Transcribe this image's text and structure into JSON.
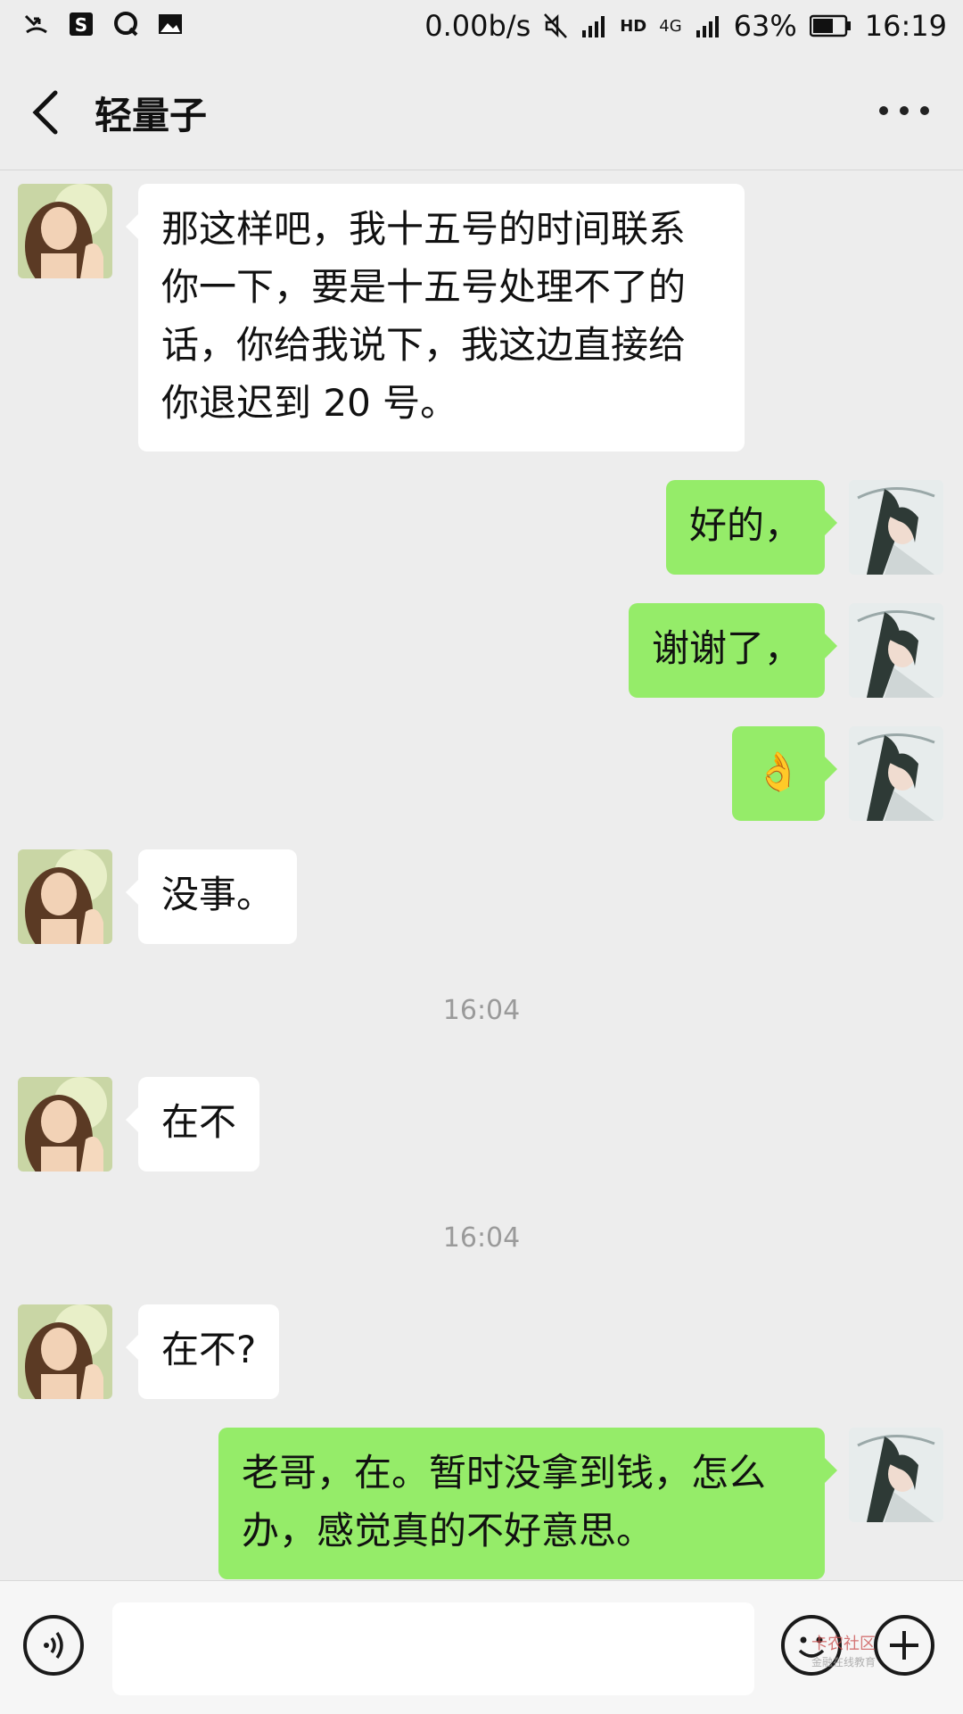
{
  "status_bar": {
    "network_speed": "0.00b/s",
    "hd_label": "HD",
    "network_type": "4G",
    "battery": "63%",
    "time": "16:19"
  },
  "header": {
    "title": "轻量子"
  },
  "messages": [
    {
      "side": "in",
      "text": "那这样吧，我十五号的时间联系你一下，要是十五号处理不了的话，你给我说下，我这边直接给你退迟到 20 号。"
    },
    {
      "side": "out",
      "text": "好的，"
    },
    {
      "side": "out",
      "text": "谢谢了，"
    },
    {
      "side": "out",
      "text": "👌"
    },
    {
      "side": "in",
      "text": "没事。"
    },
    {
      "type": "timestamp",
      "text": "16:04"
    },
    {
      "side": "in",
      "text": "在不"
    },
    {
      "type": "timestamp",
      "text": "16:04"
    },
    {
      "side": "in",
      "text": "在不?"
    },
    {
      "side": "out",
      "text": "老哥，在。暂时没拿到钱，怎么办，感觉真的不好意思。"
    }
  ],
  "watermark": {
    "line1": "卡农社区",
    "line2": "金融在线教育"
  },
  "icons": [
    "back-arrow-icon",
    "more-icon",
    "voice-icon",
    "emoji-icon",
    "plus-icon"
  ]
}
